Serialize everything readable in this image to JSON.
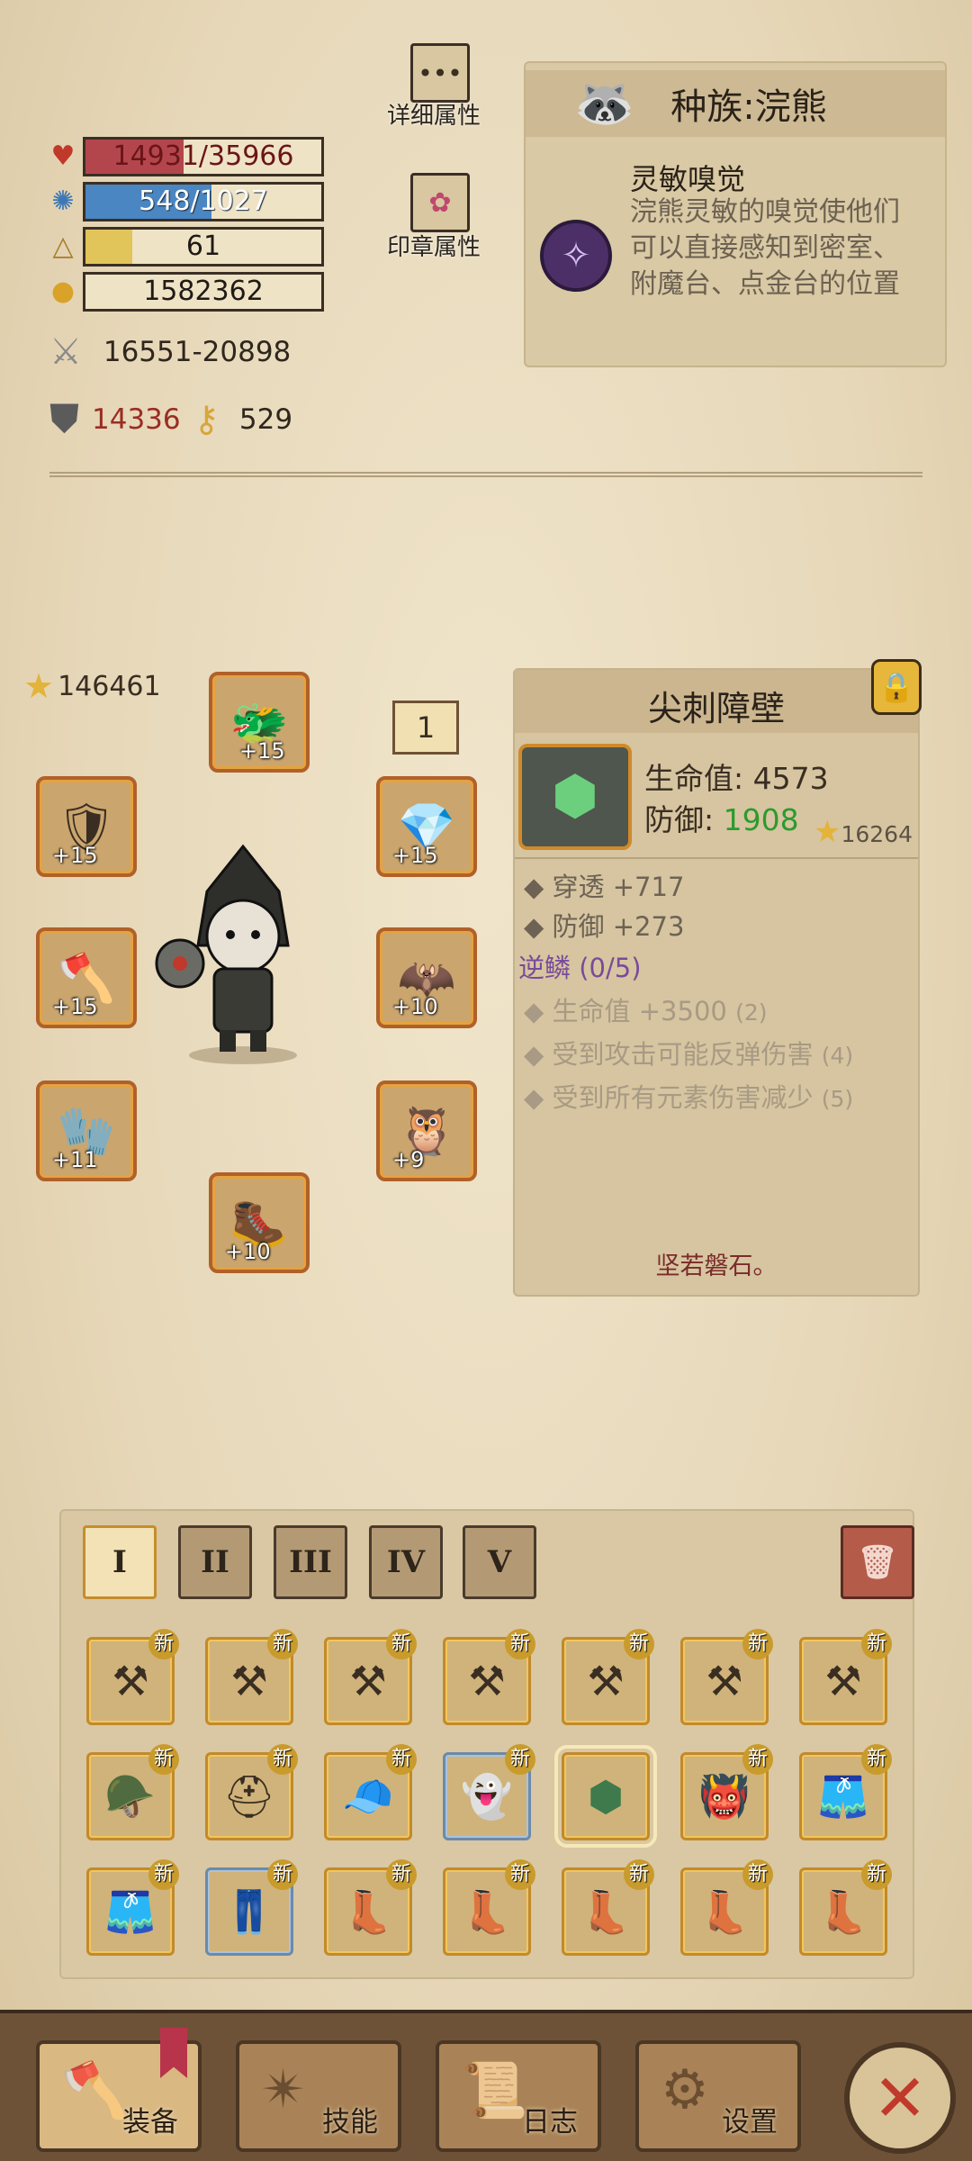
{
  "stats": {
    "hp": "14931/35966",
    "mp": "548/1027",
    "level": "61",
    "gold": "1582362",
    "damage": "16551-20898",
    "armor": "14336",
    "magic_resist": "529"
  },
  "side_buttons": {
    "details_label": "详细属性",
    "seal_label": "印章属性"
  },
  "race": {
    "title": "种族:浣熊",
    "trait_name": "灵敏嗅觉",
    "trait_desc": "浣熊灵敏的嗅觉使他们可以直接感知到密室、附魔台、点金台的位置"
  },
  "character": {
    "power": "146461",
    "page": "1",
    "slots": [
      "+15",
      "+15",
      "+15",
      "+15",
      "+10",
      "+11",
      "+9",
      "+10"
    ]
  },
  "item": {
    "name": "尖刺障壁",
    "hp_label": "生命值:",
    "hp_value": "4573",
    "def_label": "防御:",
    "def_value": "1908",
    "power": "16264",
    "attr1": "穿透 +717",
    "attr2": "防御 +273",
    "set_name": "逆鳞 (0/5)",
    "set1": "生命值 +3500",
    "set1_req": "(2)",
    "set2": "受到攻击可能反弹伤害",
    "set2_req": "(4)",
    "set3": "受到所有元素伤害减少",
    "set3_req": "(5)",
    "flavor": "坚若磐石。"
  },
  "inventory": {
    "tabs": [
      "I",
      "II",
      "III",
      "IV",
      "V"
    ],
    "new_label": "新"
  },
  "nav": {
    "equip": "装备",
    "skills": "技能",
    "log": "日志",
    "settings": "设置"
  },
  "colors": {
    "hp_fill": "#b3464d",
    "mp_fill": "#4a86c2",
    "xp_fill": "#e2c55a",
    "def_green": "#2e9a2e",
    "set_purple": "#7a4a9a",
    "armor_red": "#9a2d23"
  },
  "progress": {
    "hp": 0.415,
    "mp": 0.534,
    "xp": 0.2
  }
}
